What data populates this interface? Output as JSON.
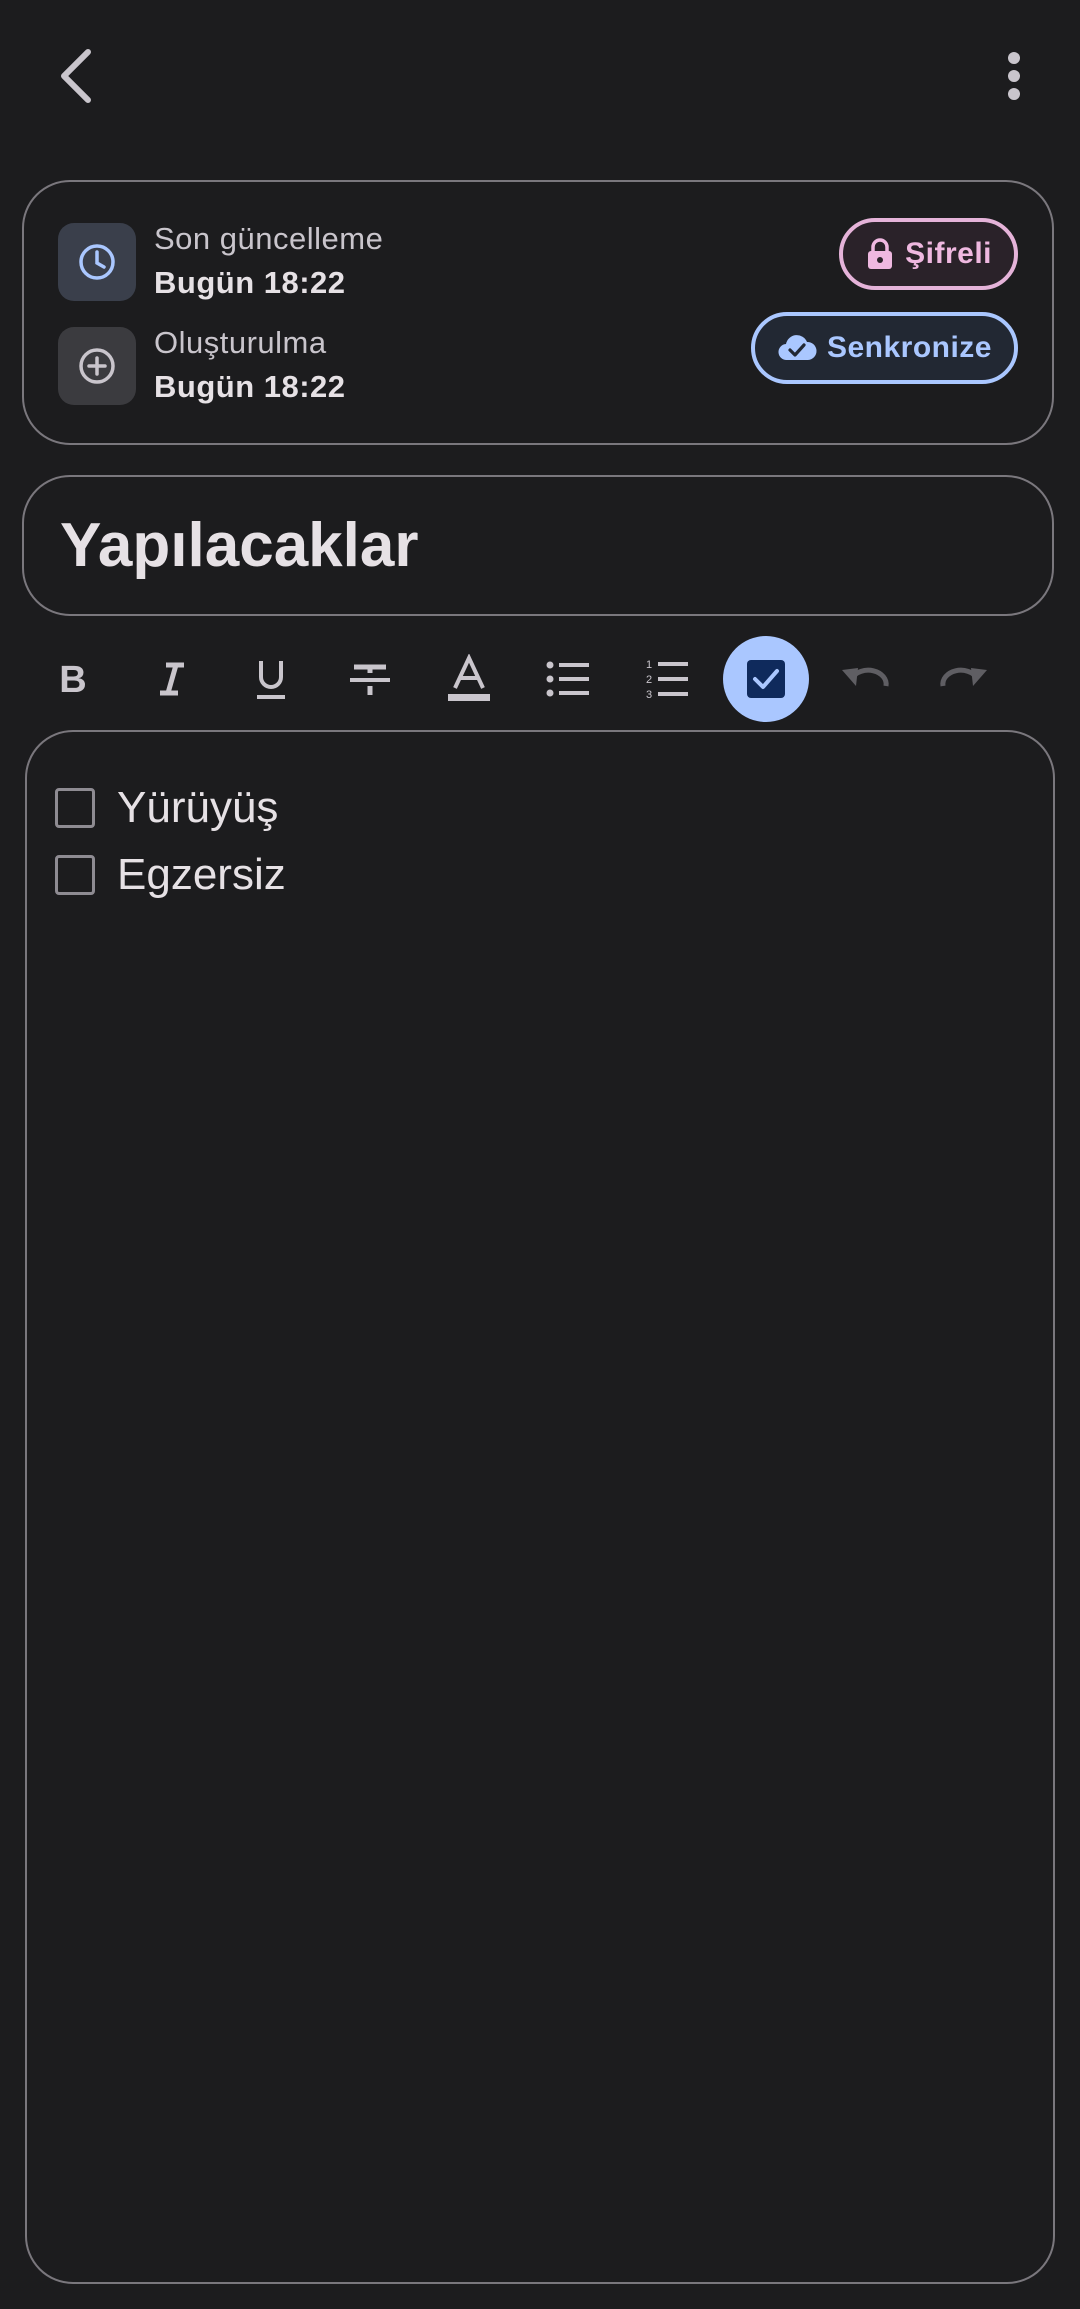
{
  "header": {
    "back_icon": "chevron-left-icon",
    "menu_icon": "more-vertical-icon"
  },
  "meta": {
    "updated_label": "Son güncelleme",
    "updated_value": "Bugün 18:22",
    "created_label": "Oluşturulma",
    "created_value": "Bugün 18:22",
    "encrypted_label": "Şifreli",
    "sync_label": "Senkronize"
  },
  "note": {
    "title": "Yapılacaklar",
    "items": [
      {
        "label": "Yürüyüş",
        "checked": false
      },
      {
        "label": "Egzersiz",
        "checked": false
      }
    ]
  },
  "toolbar": {
    "tools": [
      "bold-icon",
      "italic-icon",
      "underline-icon",
      "strikethrough-icon",
      "text-color-icon",
      "bullet-list-icon",
      "numbered-list-icon",
      "checklist-icon",
      "undo-icon",
      "redo-icon"
    ],
    "active_tool": "checklist-icon"
  },
  "colors": {
    "background": "#1c1c1e",
    "accent_blue": "#aac7ff",
    "accent_pink": "#efb8e0",
    "outline": "#7a777d"
  }
}
